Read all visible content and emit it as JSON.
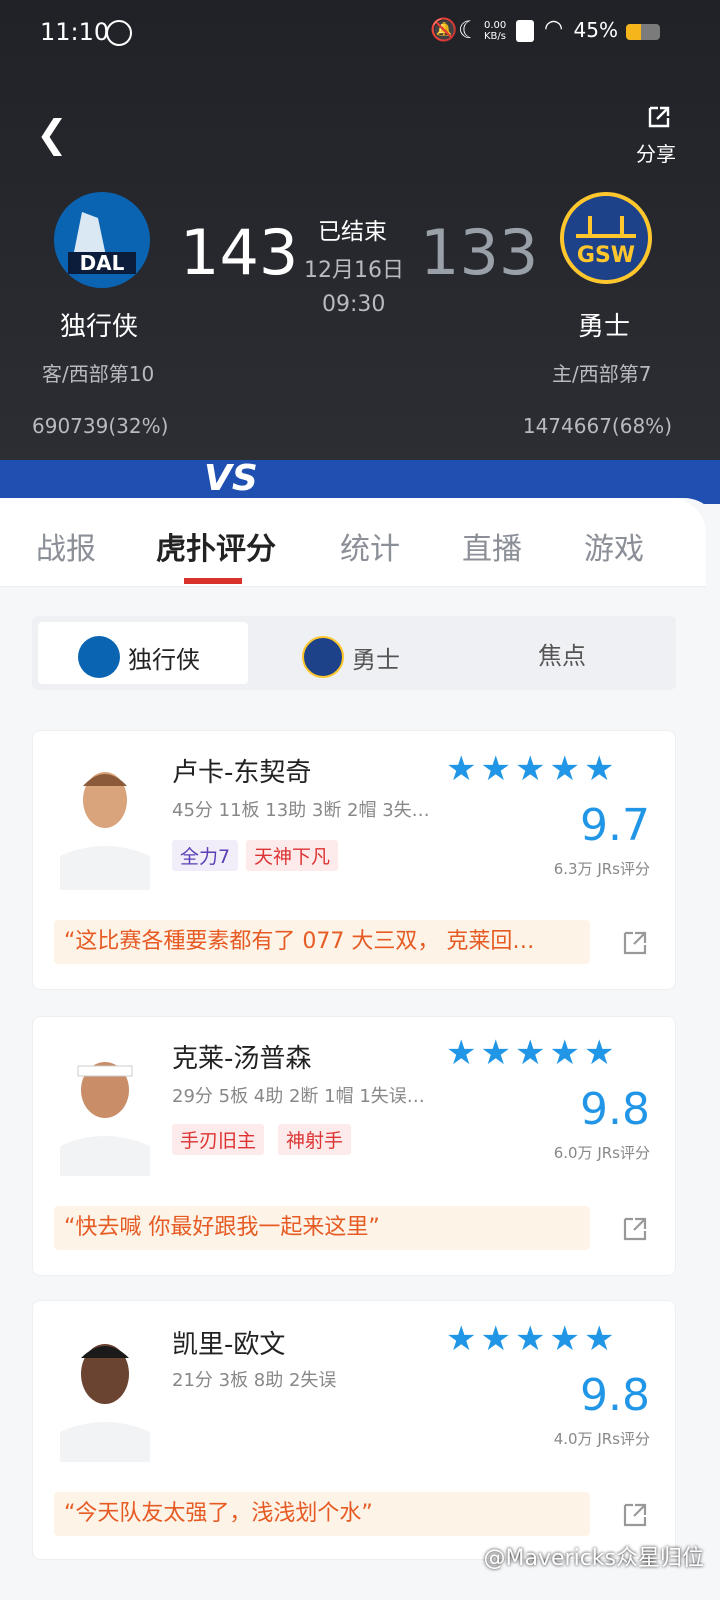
{
  "status_bar": {
    "time": "11:10",
    "net": "0.00 KB/s",
    "battery_pct": "45%",
    "battery_level": 0.45
  },
  "header": {
    "share_label": "分享"
  },
  "game": {
    "status": "已结束",
    "date": "12月16日",
    "time": "09:30",
    "home": {
      "name": "独行侠",
      "abbr": "DAL",
      "score": "143",
      "sub": "客/西部第10",
      "vote": "690739(32%)"
    },
    "away": {
      "name": "勇士",
      "abbr": "GSW",
      "score": "133",
      "sub": "主/西部第7",
      "vote": "1474667(68%)"
    }
  },
  "vs_text": "VS",
  "tabs": [
    "战报",
    "虎扑评分",
    "统计",
    "直播",
    "游戏"
  ],
  "team_switch": [
    "独行侠",
    "勇士",
    "焦点"
  ],
  "players": [
    {
      "name": "卢卡-东契奇",
      "stats": "45分 11板 13助 3断 2帽 3失…",
      "tags": [
        "全力7",
        "天神下凡"
      ],
      "rating": "9.7",
      "votes": "6.3万 JRs评分",
      "quote": "“这比赛各種要素都有了 077 大三双， 克莱回…"
    },
    {
      "name": "克莱-汤普森",
      "stats": "29分 5板 4助 2断 1帽 1失误…",
      "tags": [
        "手刃旧主",
        "神射手"
      ],
      "rating": "9.8",
      "votes": "6.0万 JRs评分",
      "quote": "“快去喊 你最好跟我一起来这里”"
    },
    {
      "name": "凯里-欧文",
      "stats": "21分 3板 8助 2失误",
      "tags": [],
      "rating": "9.8",
      "votes": "4.0万 JRs评分",
      "quote": "“今天队友太强了，浅浅划个水”"
    }
  ],
  "watermark": "@Mavericks众星归位",
  "colors": {
    "accent_blue": "#2196e6",
    "tab_red": "#d9322d",
    "quote_orange": "#e65b24"
  }
}
